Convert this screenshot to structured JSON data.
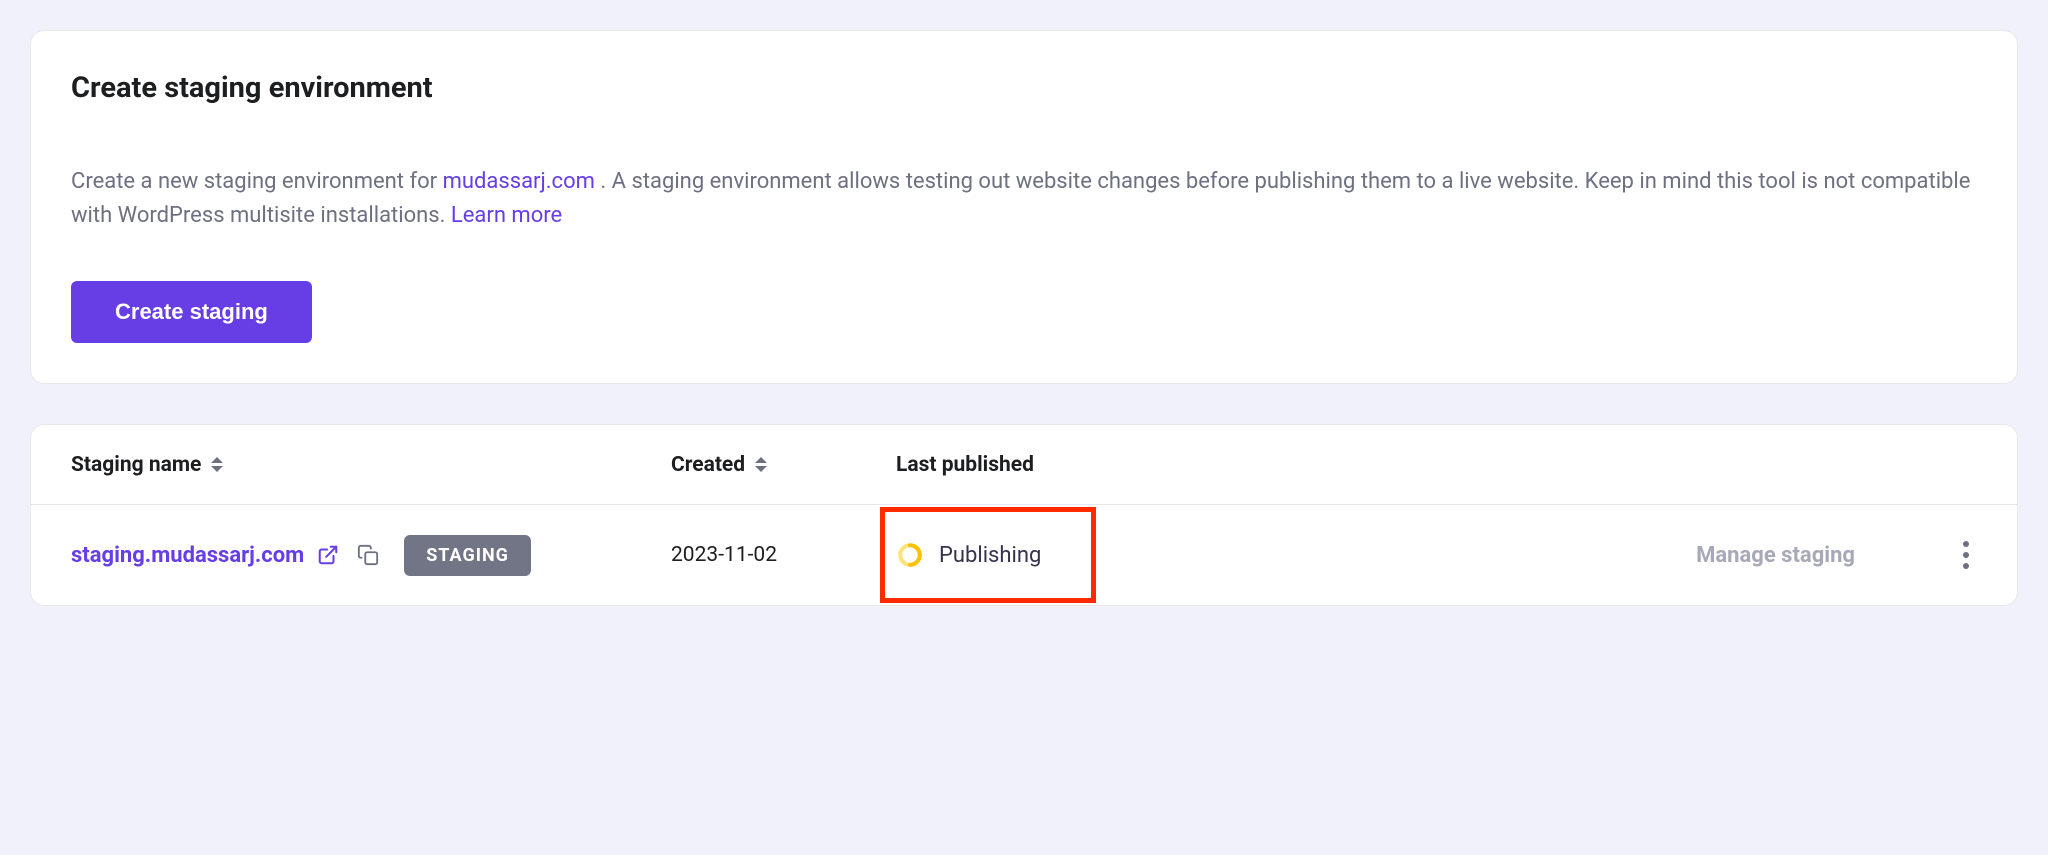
{
  "create_card": {
    "title": "Create staging environment",
    "desc_prefix": "Create a new staging environment for ",
    "domain": "mudassarj.com",
    "desc_mid": " . A staging environment allows testing out website changes before publishing them to a live website. Keep in mind this tool is not compatible with WordPress multisite installations. ",
    "learn_more": "Learn more",
    "button": "Create staging"
  },
  "table": {
    "headers": {
      "name": "Staging name",
      "created": "Created",
      "last_published": "Last published"
    },
    "rows": [
      {
        "name": "staging.mudassarj.com",
        "badge": "STAGING",
        "created": "2023-11-02",
        "status": "Publishing",
        "manage": "Manage staging"
      }
    ]
  }
}
